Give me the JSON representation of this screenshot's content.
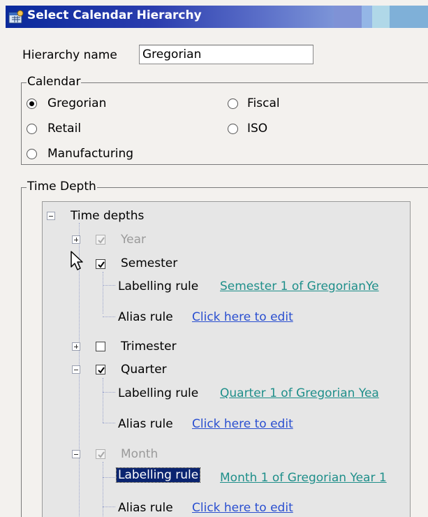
{
  "window": {
    "title": "Select Calendar Hierarchy"
  },
  "hierarchy": {
    "label": "Hierarchy name",
    "value": "Gregorian"
  },
  "calendar": {
    "legend": "Calendar",
    "options": [
      {
        "label": "Gregorian",
        "selected": true
      },
      {
        "label": "Fiscal",
        "selected": false
      },
      {
        "label": "Retail",
        "selected": false
      },
      {
        "label": "ISO",
        "selected": false
      },
      {
        "label": "Manufacturing",
        "selected": false
      }
    ]
  },
  "time_depth": {
    "legend": "Time Depth",
    "root": "Time depths",
    "year": {
      "label": "Year",
      "checked": true,
      "enabled": false,
      "expanded": false
    },
    "semester": {
      "label": "Semester",
      "checked": true,
      "expanded": true,
      "labelling_label": "Labelling rule",
      "labelling_value": "Semester 1 of GregorianYe",
      "alias_label": "Alias rule",
      "alias_value": "Click here to edit"
    },
    "trimester": {
      "label": "Trimester",
      "checked": false,
      "expanded": false
    },
    "quarter": {
      "label": "Quarter",
      "checked": true,
      "expanded": true,
      "labelling_label": "Labelling rule",
      "labelling_value": "Quarter 1 of Gregorian Yea",
      "alias_label": "Alias rule",
      "alias_value": "Click here to edit"
    },
    "month": {
      "label": "Month",
      "checked": true,
      "enabled": false,
      "expanded": true,
      "labelling_label": "Labelling rule",
      "labelling_value": "Month 1 of Gregorian Year 1",
      "alias_label": "Alias rule",
      "alias_value": "Click here to edit"
    }
  },
  "colors": {
    "title_bar": "#0a2a9c",
    "link": "#2a4fd0",
    "rule_value": "#1f8f8a",
    "selection": "#0a2470"
  }
}
